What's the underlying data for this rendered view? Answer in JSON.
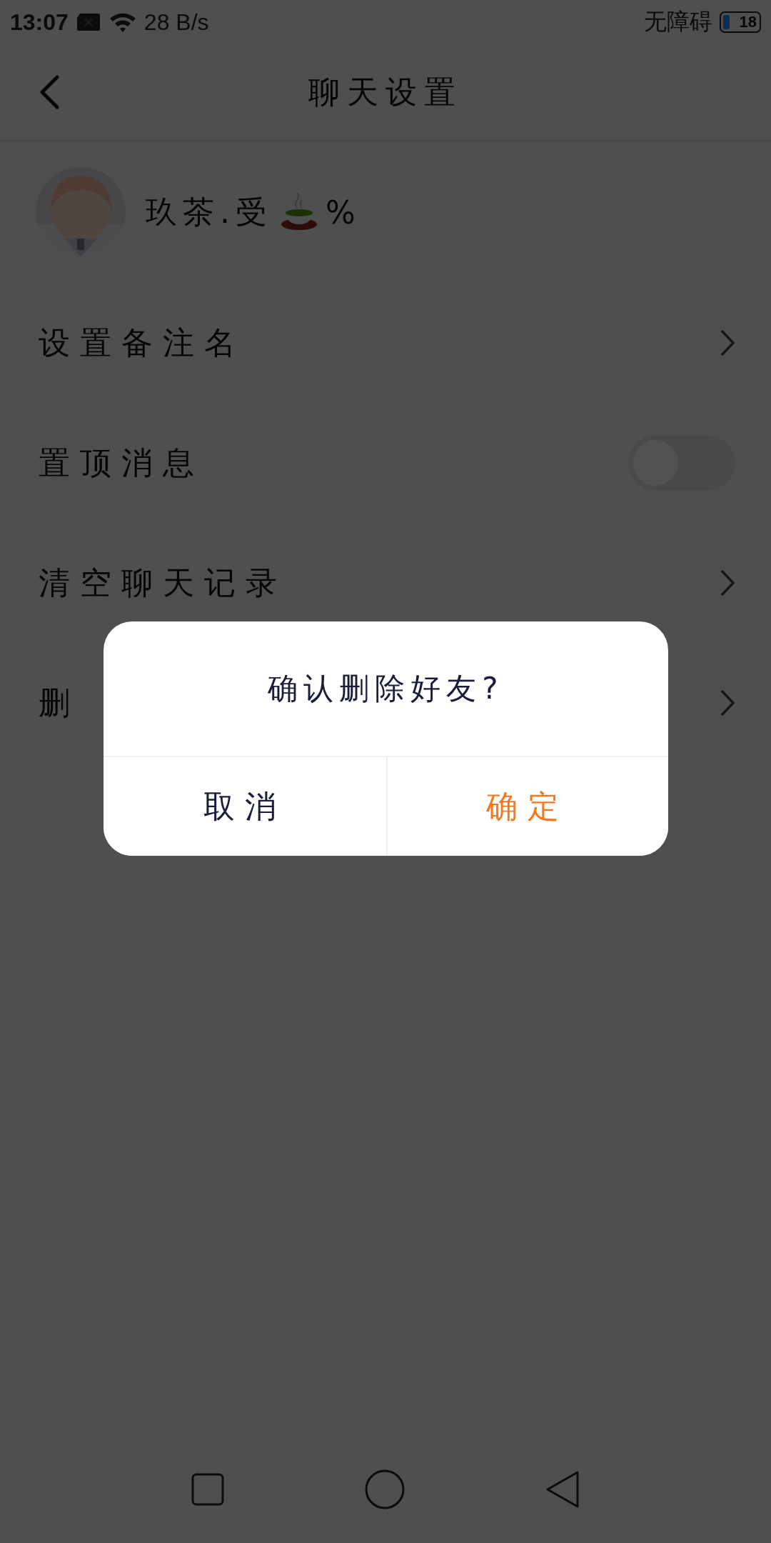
{
  "status_bar": {
    "time": "13:07",
    "speed": "28 B/s",
    "accessibility": "无障碍",
    "battery": "18"
  },
  "header": {
    "title": "聊天设置"
  },
  "profile": {
    "name": "玖茶.受",
    "suffix": "%"
  },
  "rows": [
    {
      "label": "设置备注名",
      "kind": "link"
    },
    {
      "label": "置顶消息",
      "kind": "toggle",
      "on": false
    },
    {
      "label": "清空聊天记录",
      "kind": "link"
    },
    {
      "label": "删",
      "kind": "link"
    }
  ],
  "dialog": {
    "message": "确认删除好友?",
    "buttons": [
      {
        "label": "取消",
        "kind": "cancel"
      },
      {
        "label": "确定",
        "kind": "confirm"
      }
    ]
  }
}
